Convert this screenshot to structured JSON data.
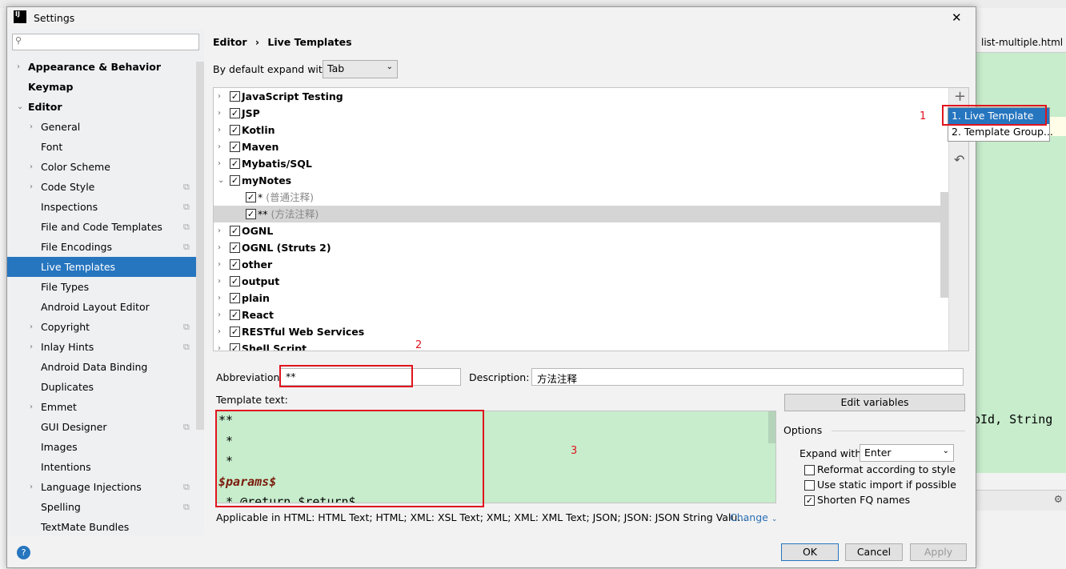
{
  "background": {
    "tab": "list-multiple.html",
    "code": "pId, String"
  },
  "dialog": {
    "title": "Settings",
    "close": "✕"
  },
  "sidebar": {
    "search_placeholder": "",
    "items": [
      {
        "label": "Appearance & Behavior",
        "level": 0,
        "arrow": "›",
        "bold": true
      },
      {
        "label": "Keymap",
        "level": 0,
        "bold": true
      },
      {
        "label": "Editor",
        "level": 0,
        "arrow": "⌄",
        "bold": true
      },
      {
        "label": "General",
        "level": 1,
        "arrow": "›"
      },
      {
        "label": "Font",
        "level": 1
      },
      {
        "label": "Color Scheme",
        "level": 1,
        "arrow": "›"
      },
      {
        "label": "Code Style",
        "level": 1,
        "arrow": "›",
        "copy": true
      },
      {
        "label": "Inspections",
        "level": 1,
        "copy": true
      },
      {
        "label": "File and Code Templates",
        "level": 1,
        "copy": true
      },
      {
        "label": "File Encodings",
        "level": 1,
        "copy": true
      },
      {
        "label": "Live Templates",
        "level": 1,
        "selected": true
      },
      {
        "label": "File Types",
        "level": 1
      },
      {
        "label": "Android Layout Editor",
        "level": 1
      },
      {
        "label": "Copyright",
        "level": 1,
        "arrow": "›",
        "copy": true
      },
      {
        "label": "Inlay Hints",
        "level": 1,
        "arrow": "›",
        "copy": true
      },
      {
        "label": "Android Data Binding",
        "level": 1
      },
      {
        "label": "Duplicates",
        "level": 1
      },
      {
        "label": "Emmet",
        "level": 1,
        "arrow": "›"
      },
      {
        "label": "GUI Designer",
        "level": 1,
        "copy": true
      },
      {
        "label": "Images",
        "level": 1
      },
      {
        "label": "Intentions",
        "level": 1
      },
      {
        "label": "Language Injections",
        "level": 1,
        "arrow": "›",
        "copy": true
      },
      {
        "label": "Spelling",
        "level": 1,
        "copy": true
      },
      {
        "label": "TextMate Bundles",
        "level": 1
      }
    ]
  },
  "breadcrumb": {
    "parent": "Editor",
    "sep": "›",
    "current": "Live Templates"
  },
  "expand": {
    "label": "By default expand with",
    "value": "Tab"
  },
  "tree": [
    {
      "label": "JavaScript Testing",
      "checked": true
    },
    {
      "label": "JSP",
      "checked": true
    },
    {
      "label": "Kotlin",
      "checked": true
    },
    {
      "label": "Maven",
      "checked": true
    },
    {
      "label": "Mybatis/SQL",
      "checked": true
    },
    {
      "label": "myNotes",
      "checked": true,
      "expanded": true
    },
    {
      "label": "*",
      "desc": "(普通注释)",
      "checked": true,
      "child": true
    },
    {
      "label": "**",
      "desc": "(方法注释)",
      "checked": true,
      "child": true,
      "selected": true
    },
    {
      "label": "OGNL",
      "checked": true
    },
    {
      "label": "OGNL (Struts 2)",
      "checked": true
    },
    {
      "label": "other",
      "checked": true
    },
    {
      "label": "output",
      "checked": true
    },
    {
      "label": "plain",
      "checked": true
    },
    {
      "label": "React",
      "checked": true
    },
    {
      "label": "RESTful Web Services",
      "checked": true
    },
    {
      "label": "Shell Script",
      "checked": true
    }
  ],
  "tools": {
    "add": "+",
    "revert": "↶"
  },
  "popup": {
    "items": [
      "1. Live Template",
      "2. Template Group..."
    ]
  },
  "annotations": {
    "one": "1",
    "two": "2",
    "three": "3"
  },
  "abbreviation": {
    "label": "Abbreviation:",
    "value": "**"
  },
  "description": {
    "label": "Description:",
    "value": "方法注释"
  },
  "template_text": {
    "label": "Template text:",
    "lines": [
      "**",
      " *",
      " *",
      "$params$",
      " * @return $return$"
    ]
  },
  "edit_variables": "Edit variables",
  "options": {
    "title": "Options",
    "expand_label": "Expand with",
    "expand_value": "Enter",
    "checks": [
      {
        "label": "Reformat according to style",
        "checked": false
      },
      {
        "label": "Use static import if possible",
        "checked": false
      },
      {
        "label": "Shorten FQ names",
        "checked": true
      }
    ]
  },
  "applicable": {
    "text": "Applicable in HTML: HTML Text; HTML; XML: XSL Text; XML; XML: XML Text; JSON; JSON: JSON String Valu...",
    "change": "Change"
  },
  "footer": {
    "help": "?",
    "ok": "OK",
    "cancel": "Cancel",
    "apply": "Apply"
  }
}
